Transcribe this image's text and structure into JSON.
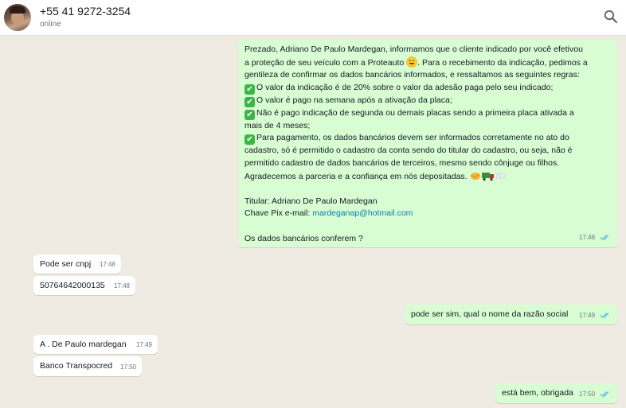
{
  "header": {
    "contact_name": "+55 41 9272-3254",
    "status": "online"
  },
  "messages": {
    "first": {
      "intro_1": "Prezado, Adriano De Paulo Mardegan, informamos que o cliente indicado por você efetivou",
      "intro_2": "a proteção de seu veículo com a Proteauto",
      "intro_2b": ". Para o recebimento da indicação, pedimos a",
      "intro_3": "gentileza de confirmar os dados bancários informados, e  ressaltamos as seguintes regras:",
      "rule_1": "O valor da indicação é de 20% sobre o valor da adesão paga pelo seu indicado;",
      "rule_2": "O valor é pago na semana após a ativação da placa;",
      "rule_3a": "Não é pago indicação de segunda ou demais placas sendo a primeira placa ativada a",
      "rule_3b": "mais de 4 meses;",
      "rule_4a": "Para pagamento, os dados bancários devem ser informados corretamente no ato do",
      "rule_4b": "cadastro, só é permitido o cadastro da conta sendo do titular do cadastro, ou seja, não é",
      "rule_4c": "permitido cadastro de dados bancários de terceiros, mesmo sendo cônjuge ou filhos.",
      "thanks": "Agradecemos a parceria e a confiança em nós depositadas.",
      "holder_label": "Titular: Adriano De Paulo Mardegan",
      "pix_label": "Chave Pix e-mail: ",
      "pix_email": "mardeganap@hotmail.com",
      "question": "Os dados bancários conferem ?",
      "time": "17:48"
    },
    "m2": {
      "text": "Pode ser cnpj",
      "time": "17:48"
    },
    "m3": {
      "text": "50764642000135",
      "time": "17:48"
    },
    "m4": {
      "text": "pode ser sim, qual o nome da razão social",
      "time": "17:49"
    },
    "m5": {
      "text": "A . De Paulo mardegan",
      "time": "17:49"
    },
    "m6": {
      "text": "Banco Transpocred",
      "time": "17:50"
    },
    "m7": {
      "text": "está bem, obrigada",
      "time": "17:50"
    }
  },
  "colors": {
    "chat_background": "#efeae2",
    "outgoing_bubble": "#d9fdd3",
    "incoming_bubble": "#ffffff",
    "read_ticks": "#53bdeb",
    "check_emoji": "#3fb549"
  }
}
